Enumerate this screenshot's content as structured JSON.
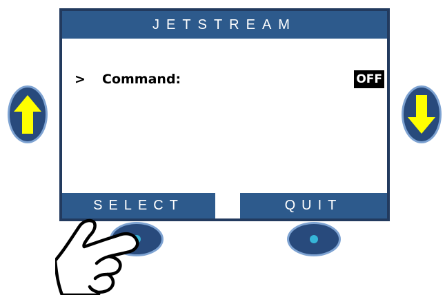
{
  "screen": {
    "title": "JETSTREAM",
    "menu": {
      "cursor": ">",
      "label": "Command:",
      "value": "OFF"
    },
    "softkeys": {
      "left": "SELECT",
      "right": "QUIT"
    }
  },
  "colors": {
    "panel_blue": "#2d5a8c",
    "button_blue": "#284a7c",
    "arrow_yellow": "#ffff00",
    "indicator_cyan": "#36b6d8"
  },
  "icons": {
    "up_button": "arrow-up-icon",
    "down_button": "arrow-down-icon",
    "pointer": "pointing-hand-icon"
  }
}
